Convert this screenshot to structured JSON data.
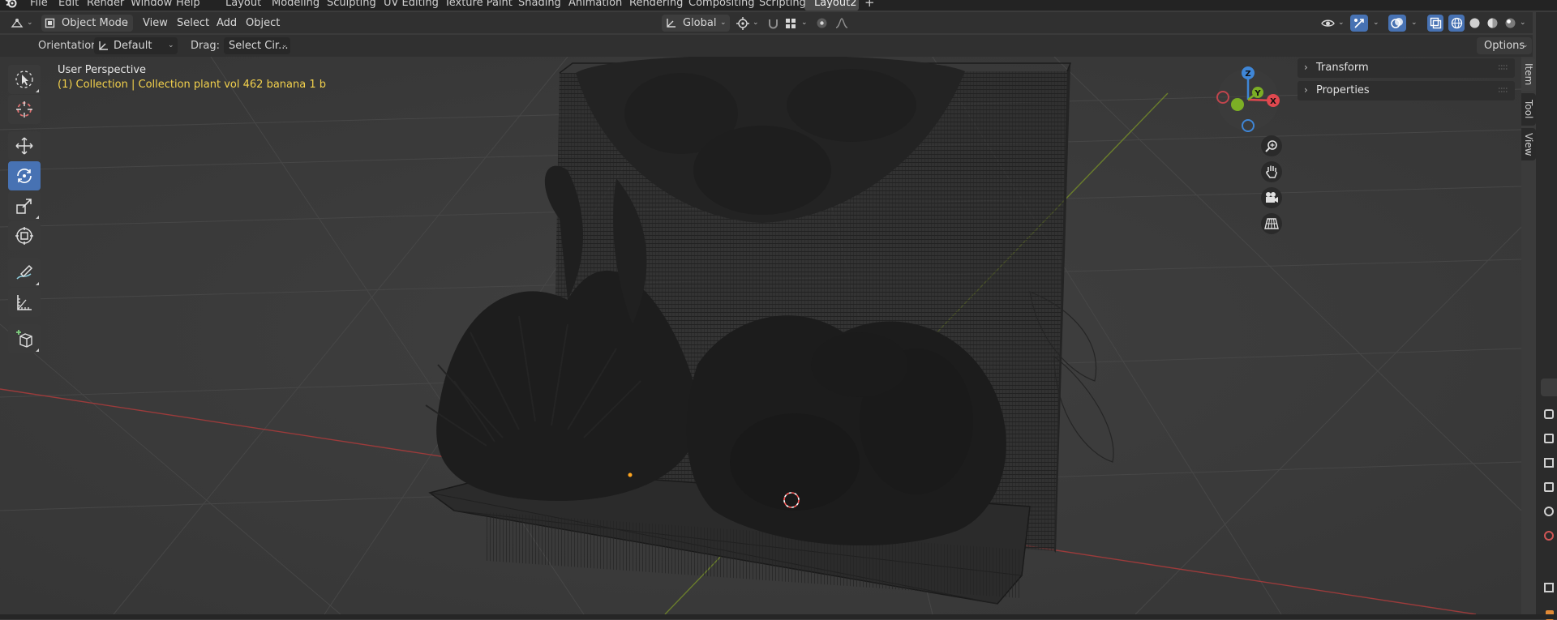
{
  "menu": {
    "items": [
      "File",
      "Edit",
      "Render",
      "Window",
      "Help"
    ],
    "workspaces": [
      "Layout",
      "Modeling",
      "Sculpting",
      "UV Editing",
      "Texture Paint",
      "Shading",
      "Animation",
      "Rendering",
      "Compositing",
      "Scripting",
      "Layout2"
    ],
    "active_workspace": "Layout2",
    "add_tab": "+"
  },
  "header": {
    "mode": "Object Mode",
    "menus": [
      "View",
      "Select",
      "Add",
      "Object"
    ],
    "transform_orientation": "Global",
    "options_label": "Options"
  },
  "tool_settings": {
    "orientation_label": "Orientation:",
    "orientation_value": "Default",
    "drag_label": "Drag:",
    "drag_value": "Select Cir..."
  },
  "viewport": {
    "perspective": "User Perspective",
    "collection": "(1) Collection | Collection plant vol 462 banana 1  b"
  },
  "gizmo": {
    "x": "X",
    "y": "Y",
    "z": "Z"
  },
  "sidebar": {
    "panels": [
      "Transform",
      "Properties"
    ],
    "tabs": [
      "Item",
      "Tool",
      "View"
    ]
  },
  "colors": {
    "selection_text": "#f3d14c",
    "active_tool": "#4772b3",
    "axis_x": "#e0484f",
    "axis_y": "#7cae25",
    "axis_z": "#3f86d6"
  },
  "icons": [
    "blender-logo-icon",
    "editor-type-icon",
    "object-mode-icon",
    "transform-orientation-icon",
    "pivot-icon",
    "snap-icon",
    "snap-increment-icon",
    "proportional-edit-icon",
    "falloff-icon",
    "visibility-icon",
    "gizmo-icon",
    "overlay-icon",
    "xray-icon",
    "wireframe-shading-icon",
    "solid-shading-icon",
    "material-shading-icon",
    "rendered-shading-icon",
    "select-circle-icon",
    "cursor-icon",
    "move-icon",
    "rotate-icon",
    "scale-icon",
    "transform-icon",
    "annotate-icon",
    "measure-icon",
    "add-cube-icon",
    "zoom-icon",
    "hand-pan-icon",
    "camera-icon",
    "perspective-grid-icon",
    "chevron-right-icon",
    "drag-grip-icon"
  ]
}
